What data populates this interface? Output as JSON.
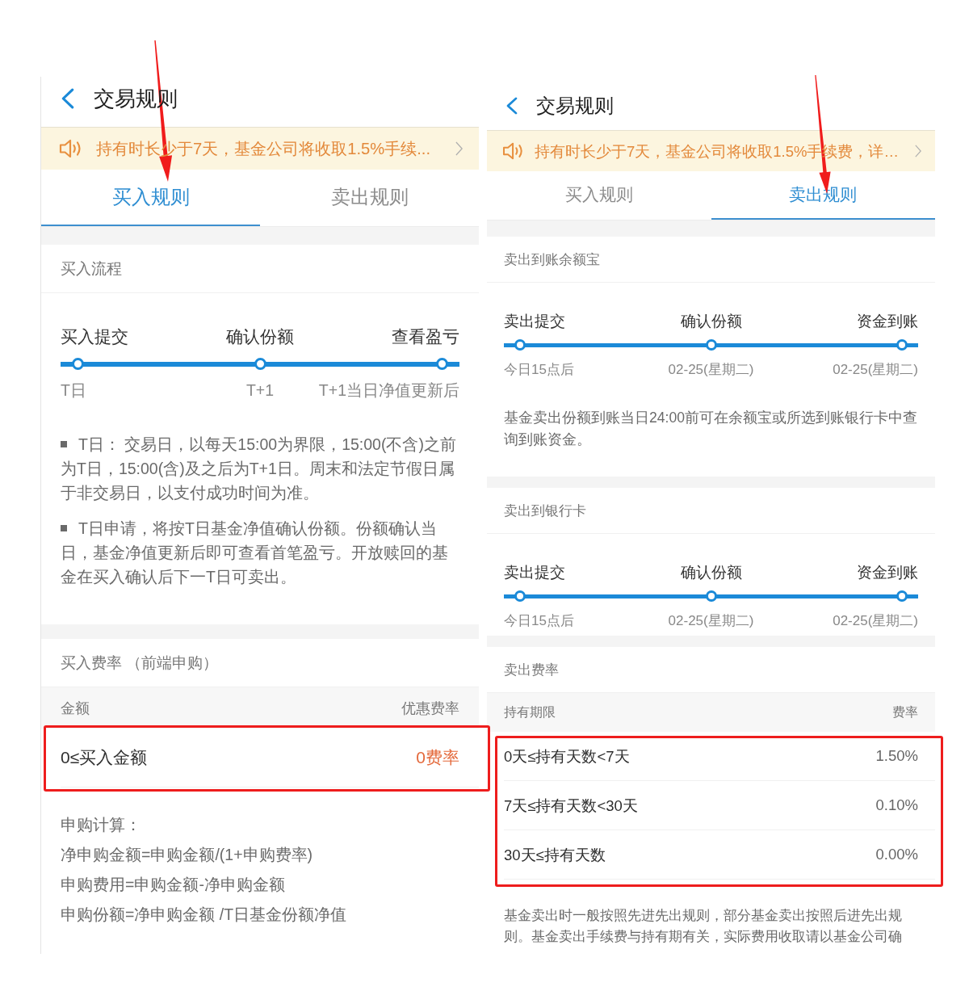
{
  "screens": [
    {
      "title": "交易规则",
      "notice": "持有时长少于7天，基金公司将收取1.5%手续...",
      "tabs": [
        {
          "label": "买入规则",
          "selected": true,
          "arrow": true
        },
        {
          "label": "卖出规则",
          "selected": false,
          "arrow": false
        }
      ],
      "sections": [
        {
          "kind": "timeline",
          "title": "买入流程",
          "steps": [
            {
              "label": "买入提交",
              "time": "T日"
            },
            {
              "label": "确认份额",
              "time": "T+1"
            },
            {
              "label": "查看盈亏",
              "time": "T+1当日净值更新后"
            }
          ],
          "notes": [
            {
              "text": "T日： 交易日，以每天15:00为界限，15:00(不含)之前为T日，15:00(含)及之后为T+1日。周末和法定节假日属于非交易日，以支付成功时间为准。",
              "bullet": true
            },
            {
              "text": "T日申请，将按T日基金净值确认份额。份额确认当日，基金净值更新后即可查看首笔盈亏。开放赎回的基金在买入确认后下一T日可卖出。",
              "bullet": true
            }
          ]
        },
        {
          "kind": "fee_table",
          "title": "买入费率 （前端申购）",
          "columns": [
            "金额",
            "优惠费率"
          ],
          "highlighted": true,
          "rows": [
            {
              "range": "0≤买入金额",
              "rate": "0费率",
              "discount": true
            }
          ],
          "notes": [
            {
              "text": "申购计算：",
              "bullet": false
            },
            {
              "text": "净申购金额=申购金额/(1+申购费率)",
              "bullet": false
            },
            {
              "text": "申购费用=申购金额-净申购金额",
              "bullet": false
            },
            {
              "text": "申购份额=净申购金额 /T日基金份额净值",
              "bullet": false
            }
          ]
        }
      ]
    },
    {
      "title": "交易规则",
      "notice": "持有时长少于7天，基金公司将收取1.5%手续费，详…",
      "tabs": [
        {
          "label": "买入规则",
          "selected": false,
          "arrow": false
        },
        {
          "label": "卖出规则",
          "selected": true,
          "arrow": true
        }
      ],
      "sections": [
        {
          "kind": "timeline",
          "title": "卖出到账余额宝",
          "steps": [
            {
              "label": "卖出提交",
              "time": "今日15点后"
            },
            {
              "label": "确认份额",
              "time": "02-25(星期二)"
            },
            {
              "label": "资金到账",
              "time": "02-25(星期二)"
            }
          ],
          "notes": [
            {
              "text": "基金卖出份额到账当日24:00前可在余额宝或所选到账银行卡中查询到账资金。",
              "bullet": false
            }
          ]
        },
        {
          "kind": "timeline",
          "title": "卖出到银行卡",
          "steps": [
            {
              "label": "卖出提交",
              "time": "今日15点后"
            },
            {
              "label": "确认份额",
              "time": "02-25(星期二)"
            },
            {
              "label": "资金到账",
              "time": "02-25(星期二)"
            }
          ]
        },
        {
          "kind": "fee_table",
          "title": "卖出费率",
          "columns": [
            "持有期限",
            "费率"
          ],
          "highlighted": true,
          "rows": [
            {
              "range": "0天≤持有天数<7天",
              "rate": "1.50%",
              "discount": false
            },
            {
              "range": "7天≤持有天数<30天",
              "rate": "0.10%",
              "discount": false
            },
            {
              "range": "30天≤持有天数",
              "rate": "0.00%",
              "discount": false
            }
          ],
          "notes": [
            {
              "text": "基金卖出时一般按照先进先出规则，部分基金卖出按照后进先出规则。基金卖出手续费与持有期有关，实际费用收取请以基金公司确",
              "bullet": false
            }
          ]
        }
      ]
    }
  ]
}
